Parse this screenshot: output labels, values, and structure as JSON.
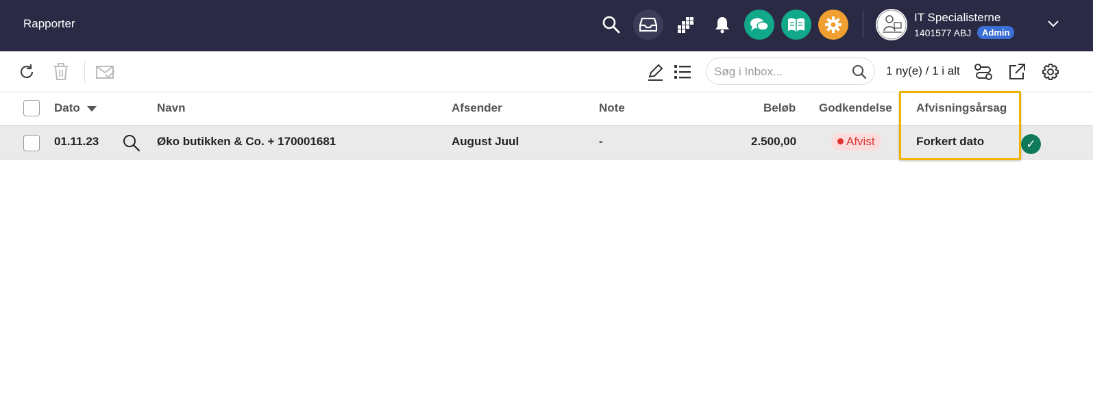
{
  "header": {
    "title": "Rapporter",
    "icons": [
      "search-icon",
      "inbox-icon",
      "apps-grid-icon",
      "bell-icon",
      "chat-icon",
      "book-icon",
      "gear-icon"
    ],
    "colors": {
      "bar": "#2a2a45",
      "chat": "#12a98a",
      "book": "#12a98a",
      "gear": "#f0a030",
      "inbox_active": "#3c3c58"
    },
    "user": {
      "name": "IT Specialisterne",
      "id": "1401577 ABJ",
      "role": "Admin"
    }
  },
  "toolbar": {
    "search_placeholder": "Søg i Inbox...",
    "counter": "1 ny(e) / 1 i alt",
    "icons": [
      "refresh-icon",
      "trash-icon",
      "mail-check-icon",
      "edit-icon",
      "list-icon",
      "search-icon",
      "flow-icon",
      "external-link-icon",
      "settings-icon"
    ]
  },
  "table": {
    "columns": {
      "dato": "Dato",
      "navn": "Navn",
      "afsender": "Afsender",
      "note": "Note",
      "beloeb": "Beløb",
      "godkendelse": "Godkendelse",
      "afvisning": "Afvisningsårsag"
    },
    "rows": [
      {
        "dato": "01.11.23",
        "navn": "Øko butikken & Co. + 170001681",
        "afsender": "August Juul",
        "note": "-",
        "beloeb": "2.500,00",
        "godkendelse": "Afvist",
        "afvisning": "Forkert dato"
      }
    ]
  },
  "accent": {
    "highlight": "#f0b400",
    "rejected": "#d33333",
    "approved": "#0e7a5a",
    "admin": "#3b6fd6"
  }
}
